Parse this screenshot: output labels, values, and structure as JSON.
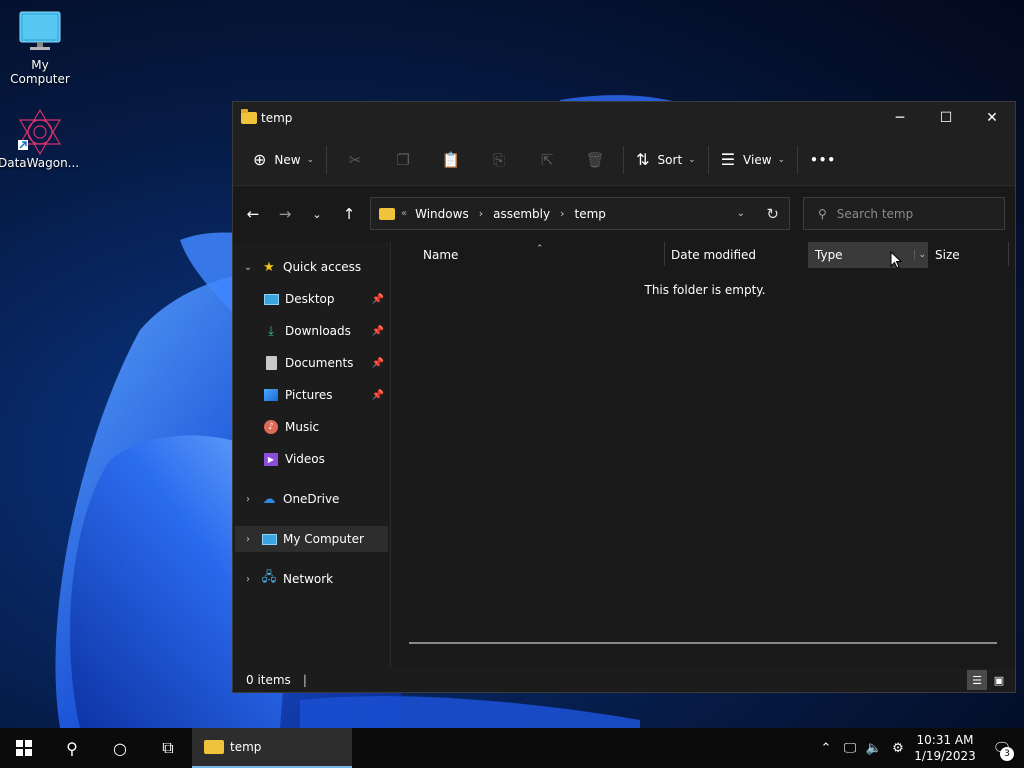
{
  "desktop": {
    "icons": [
      {
        "label": "My Computer",
        "icon": "monitor-icon"
      },
      {
        "label": "DataWagon...",
        "icon": "datawagon-app-icon"
      }
    ]
  },
  "window": {
    "title": "temp",
    "controls": {
      "minimize": "─",
      "maximize": "☐",
      "close": "✕"
    },
    "command_bar": {
      "new_label": "New",
      "sort_label": "Sort",
      "view_label": "View",
      "more_label": "•••",
      "disabled_icons": [
        "cut-icon",
        "copy-icon",
        "paste-icon",
        "rename-icon",
        "share-icon",
        "delete-icon"
      ]
    },
    "address_bar": {
      "overflow": "«",
      "crumbs": [
        "Windows",
        "assembly",
        "temp"
      ]
    },
    "search": {
      "placeholder": "Search temp"
    },
    "sidebar": {
      "quick_access": "Quick access",
      "items": [
        {
          "label": "Desktop",
          "pinned": true
        },
        {
          "label": "Downloads",
          "pinned": true
        },
        {
          "label": "Documents",
          "pinned": true
        },
        {
          "label": "Pictures",
          "pinned": true
        },
        {
          "label": "Music",
          "pinned": false
        },
        {
          "label": "Videos",
          "pinned": false
        }
      ],
      "onedrive": "OneDrive",
      "my_computer": "My Computer",
      "network": "Network"
    },
    "columns": {
      "name": "Name",
      "date_modified": "Date modified",
      "type": "Type",
      "size": "Size"
    },
    "empty_message": "This folder is empty.",
    "status": {
      "items": "0 items"
    }
  },
  "taskbar": {
    "app_label": "temp",
    "time": "10:31 AM",
    "date": "1/19/2023",
    "notification_count": "3"
  },
  "colors": {
    "accent": "#76b9ed",
    "folder": "#f0c33c",
    "window_bg": "#191919"
  }
}
